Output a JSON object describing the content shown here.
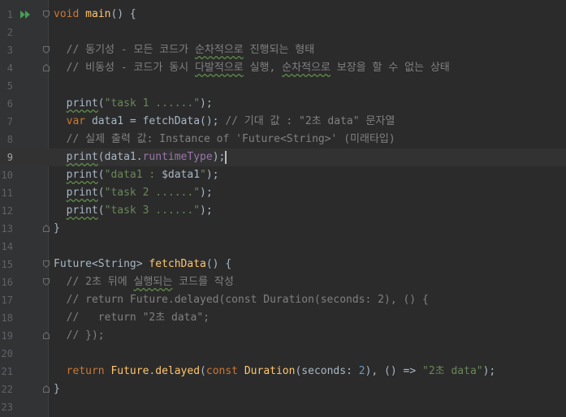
{
  "editor": {
    "language": "Dart",
    "current_line": 9,
    "lines": [
      {
        "n": "1",
        "text": "void main() {"
      },
      {
        "n": "2",
        "text": ""
      },
      {
        "n": "3",
        "text": "  // 동기성 - 모든 코드가 순차적으로 진행되는 형태"
      },
      {
        "n": "4",
        "text": "  // 비동성 - 코드가 동시 다발적으로 실행, 순차적으로 보장을 할 수 없는 상태"
      },
      {
        "n": "5",
        "text": ""
      },
      {
        "n": "6",
        "text": "  print(\"task 1 ......\");"
      },
      {
        "n": "7",
        "text": "  var data1 = fetchData(); // 기대 값 : \"2초 data\" 문자열"
      },
      {
        "n": "8",
        "text": "  // 실제 출력 값: Instance of 'Future<String>' (미래타입)"
      },
      {
        "n": "9",
        "text": "  print(data1.runtimeType);"
      },
      {
        "n": "10",
        "text": "  print(\"data1 : $data1\");"
      },
      {
        "n": "11",
        "text": "  print(\"task 2 ......\");"
      },
      {
        "n": "12",
        "text": "  print(\"task 3 ......\");"
      },
      {
        "n": "13",
        "text": "}"
      },
      {
        "n": "14",
        "text": ""
      },
      {
        "n": "15",
        "text": "Future<String> fetchData() {"
      },
      {
        "n": "16",
        "text": "  // 2초 뒤에 실행되는 코드를 작성"
      },
      {
        "n": "17",
        "text": "  // return Future.delayed(const Duration(seconds: 2), () {"
      },
      {
        "n": "18",
        "text": "  //   return \"2초 data\";"
      },
      {
        "n": "19",
        "text": "  // });"
      },
      {
        "n": "20",
        "text": ""
      },
      {
        "n": "21",
        "text": "  return Future.delayed(const Duration(seconds: 2), () => \"2초 data\");"
      },
      {
        "n": "22",
        "text": "}"
      },
      {
        "n": "23",
        "text": ""
      }
    ]
  },
  "colors": {
    "background": "#2b2b2b",
    "gutter": "#313335",
    "keyword": "#cc7832",
    "function": "#ffc66d",
    "string": "#6a8759",
    "comment": "#808080",
    "number": "#6897bb",
    "run_icon": "#499c54"
  },
  "icons": {
    "run": "run-gutter-icon",
    "fold": "fold-marker-icon"
  }
}
